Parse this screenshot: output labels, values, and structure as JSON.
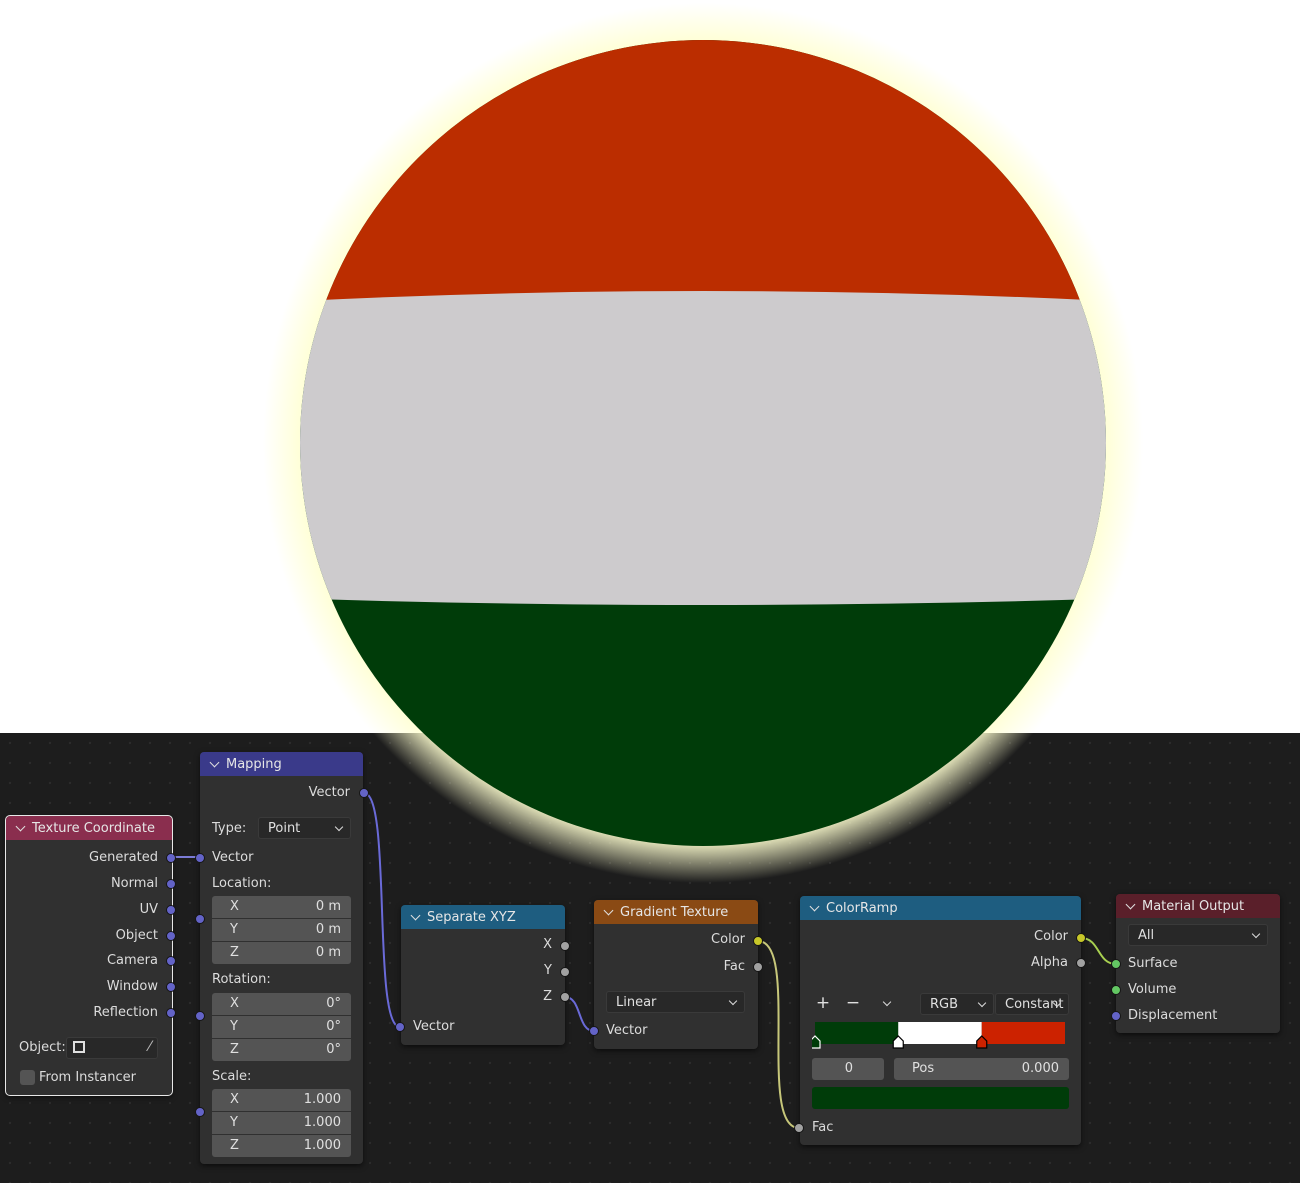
{
  "preview": {
    "flag_colors": {
      "top": "#BB2D00",
      "middle": "#CDCBCD",
      "bottom": "#003C09"
    },
    "glow_color": "#FFFFD0"
  },
  "nodes": {
    "texture_coordinate": {
      "title": "Texture Coordinate",
      "header_color": "#8A2E4E",
      "outputs": [
        "Generated",
        "Normal",
        "UV",
        "Object",
        "Camera",
        "Window",
        "Reflection"
      ],
      "object_label": "Object:",
      "from_instancer_label": "From Instancer",
      "from_instancer_checked": false
    },
    "mapping": {
      "title": "Mapping",
      "header_color": "#3A3A8A",
      "output": "Vector",
      "type_label": "Type:",
      "type_value": "Point",
      "input_vector": "Vector",
      "location_label": "Location:",
      "location": [
        {
          "axis": "X",
          "value": "0 m"
        },
        {
          "axis": "Y",
          "value": "0 m"
        },
        {
          "axis": "Z",
          "value": "0 m"
        }
      ],
      "rotation_label": "Rotation:",
      "rotation": [
        {
          "axis": "X",
          "value": "0°"
        },
        {
          "axis": "Y",
          "value": "0°"
        },
        {
          "axis": "Z",
          "value": "0°"
        }
      ],
      "scale_label": "Scale:",
      "scale": [
        {
          "axis": "X",
          "value": "1.000"
        },
        {
          "axis": "Y",
          "value": "1.000"
        },
        {
          "axis": "Z",
          "value": "1.000"
        }
      ]
    },
    "separate_xyz": {
      "title": "Separate XYZ",
      "header_color": "#1E5D80",
      "outputs": [
        "X",
        "Y",
        "Z"
      ],
      "input": "Vector"
    },
    "gradient_texture": {
      "title": "Gradient Texture",
      "header_color": "#8A4A14",
      "outputs": [
        "Color",
        "Fac"
      ],
      "type_value": "Linear",
      "input": "Vector"
    },
    "color_ramp": {
      "title": "ColorRamp",
      "header_color": "#1E5D80",
      "outputs": [
        "Color",
        "Alpha"
      ],
      "color_mode": "RGB",
      "interpolation": "Constant",
      "add_label": "+",
      "remove_label": "−",
      "stops": [
        {
          "pos": 0.0,
          "color": "#003C09"
        },
        {
          "pos": 0.333,
          "color": "#FFFFFF"
        },
        {
          "pos": 0.667,
          "color": "#CC2200"
        }
      ],
      "active_index": "0",
      "pos_label": "Pos",
      "pos_value": "0.000",
      "active_color": "#003C09",
      "input": "Fac"
    },
    "material_output": {
      "title": "Material Output",
      "header_color": "#5A1F2A",
      "target": "All",
      "inputs": [
        "Surface",
        "Volume",
        "Displacement"
      ]
    }
  }
}
